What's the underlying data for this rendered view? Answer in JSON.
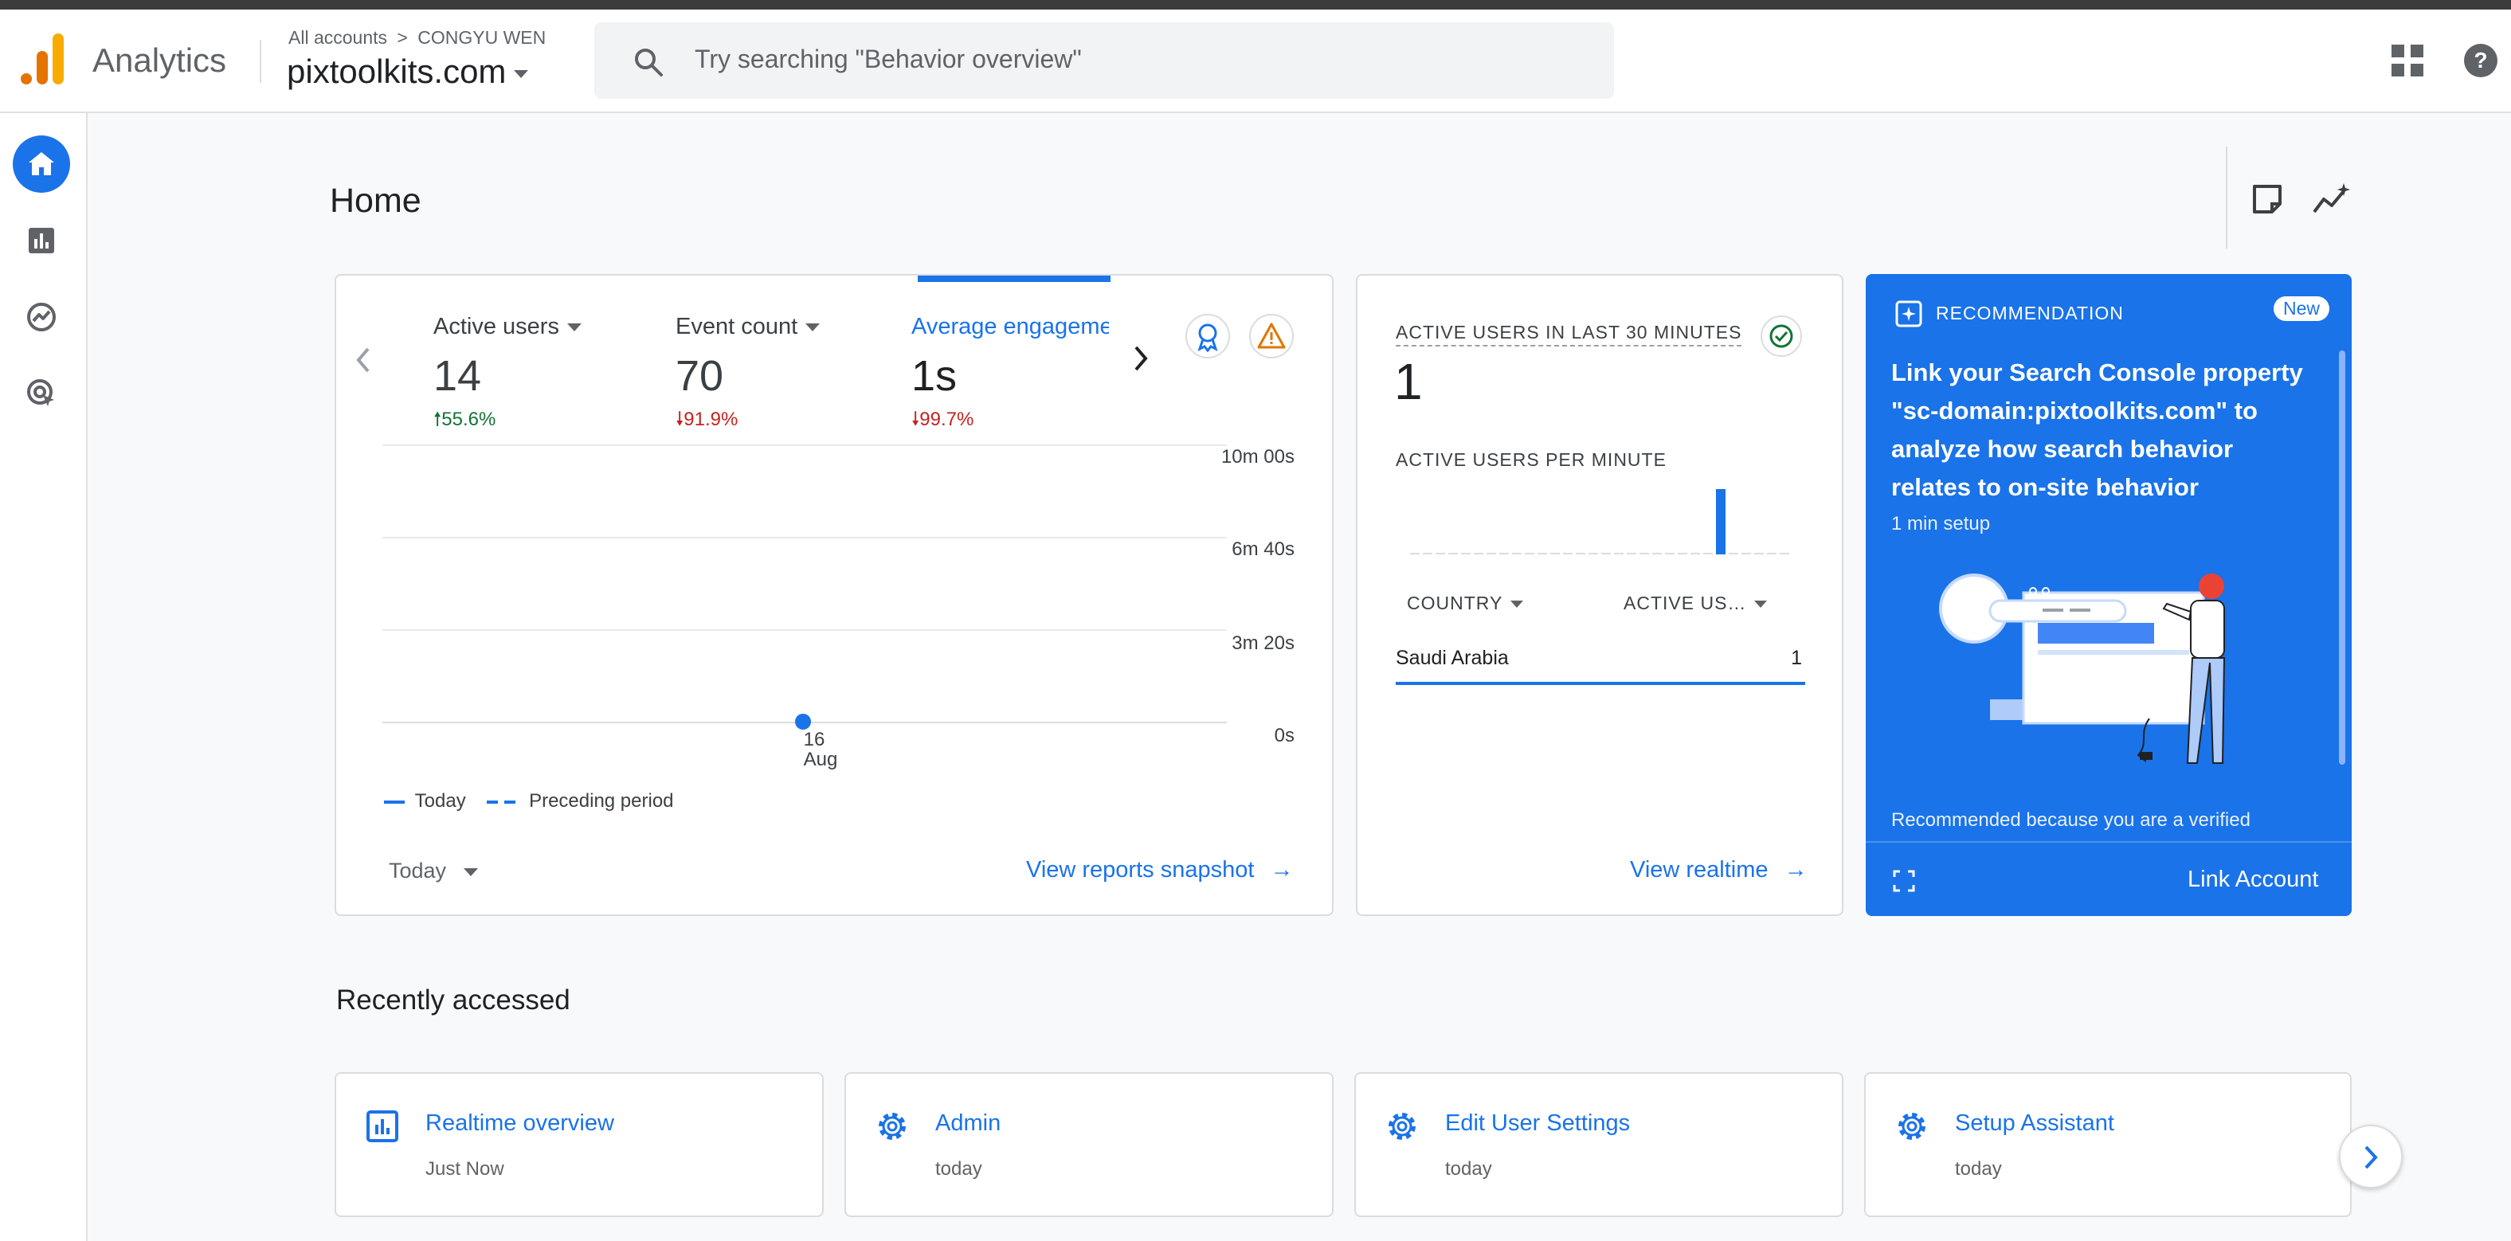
{
  "header": {
    "app_name": "Analytics",
    "breadcrumb_all": "All accounts",
    "breadcrumb_sep": ">",
    "breadcrumb_account": "CONGYU WEN",
    "property": "pixtoolkits.com",
    "search_placeholder": "Try searching \"Behavior overview\""
  },
  "page": {
    "title": "Home"
  },
  "metrics": [
    {
      "label": "Active users",
      "value": "14",
      "change": "55.6%",
      "direction": "up"
    },
    {
      "label": "Event count",
      "value": "70",
      "change": "91.9%",
      "direction": "down"
    },
    {
      "label": "Average engageme",
      "value": "1s",
      "change": "99.7%",
      "direction": "down"
    }
  ],
  "chart_data": {
    "type": "line",
    "y_ticks": [
      "10m 00s",
      "6m 40s",
      "3m 20s",
      "0s"
    ],
    "x_ticks": [
      {
        "day": "16",
        "month": "Aug"
      }
    ],
    "series": [
      {
        "name": "Today",
        "style": "solid",
        "color": "#1a73e8",
        "points": [
          {
            "x": "16 Aug",
            "y": 1
          }
        ]
      },
      {
        "name": "Preceding period",
        "style": "dashed",
        "color": "#1a73e8",
        "points": []
      }
    ],
    "ylim": [
      "0s",
      "10m 00s"
    ]
  },
  "overview": {
    "legend_today": "Today",
    "legend_preceding": "Preceding period",
    "date_range": "Today",
    "view_link": "View reports snapshot"
  },
  "realtime": {
    "title": "ACTIVE USERS IN LAST 30 MINUTES",
    "value": "1",
    "per_minute_label": "ACTIVE USERS PER MINUTE",
    "per_minute_bars": [
      0,
      0,
      0,
      0,
      0,
      0,
      0,
      0,
      0,
      0,
      0,
      0,
      0,
      0,
      0,
      0,
      0,
      0,
      0,
      0,
      0,
      0,
      0,
      0,
      1,
      0,
      0,
      0,
      0,
      0
    ],
    "col_country": "COUNTRY",
    "col_users": "ACTIVE US…",
    "rows": [
      {
        "country": "Saudi Arabia",
        "users": "1"
      }
    ],
    "view_link": "View realtime"
  },
  "recommendation": {
    "label": "RECOMMENDATION",
    "badge": "New",
    "text": "Link your Search Console property \"sc-domain:pixtoolkits.com\" to analyze how search behavior relates to on-site behavior",
    "setup": "1 min setup",
    "footer_note": "Recommended because you are a verified",
    "action": "Link Account"
  },
  "recent": {
    "title": "Recently accessed",
    "items": [
      {
        "title": "Realtime overview",
        "sub": "Just Now",
        "icon": "report-icon"
      },
      {
        "title": "Admin",
        "sub": "today",
        "icon": "gear-icon"
      },
      {
        "title": "Edit User Settings",
        "sub": "today",
        "icon": "gear-icon"
      },
      {
        "title": "Setup Assistant",
        "sub": "today",
        "icon": "gear-icon"
      }
    ]
  },
  "colors": {
    "accent": "#1a73e8",
    "up": "#137333",
    "down": "#c5221f",
    "logo_orange": "#f9ab00",
    "logo_dark": "#e37400"
  }
}
